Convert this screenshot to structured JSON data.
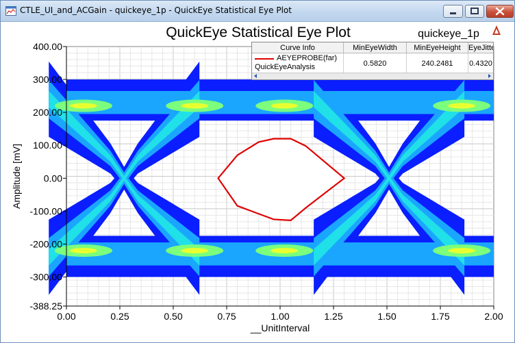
{
  "window": {
    "title": "CTLE_UI_and_ACGain - quickeye_1p - QuickEye Statistical Eye Plot",
    "icon": "app-icon",
    "controls": [
      "minimize-icon",
      "maximize-icon",
      "close-icon"
    ]
  },
  "plot": {
    "title": "QuickEye Statistical Eye Plot",
    "subtitle": "quickeye_1p",
    "logo": "ansys-logo",
    "xlabel": "__UnitInterval",
    "ylabel": "Amplitude [mV]"
  },
  "legend": {
    "columns": [
      "Curve Info",
      "MinEyeWidth",
      "MinEyeHeight",
      "EyeJitte..."
    ],
    "rows": [
      {
        "curve_line1": "AEYEPROBE(far)",
        "curve_line2": "QuickEyeAnalysis",
        "curve_color": "#e00000",
        "values": [
          "0.5820",
          "240.2481",
          "0.4320"
        ]
      }
    ]
  },
  "chart_data": {
    "type": "heatmap",
    "title": "QuickEye Statistical Eye Plot",
    "subtitle": "quickeye_1p",
    "xlabel": "__UnitInterval",
    "ylabel": "Amplitude [mV]",
    "xlim": [
      0,
      2
    ],
    "ylim": [
      -388.25,
      400
    ],
    "xticks": [
      "0.00",
      "0.25",
      "0.50",
      "0.75",
      "1.00",
      "1.25",
      "1.50",
      "1.75",
      "2.00"
    ],
    "yticks": [
      "400.00",
      "300.00",
      "200.00",
      "100.00",
      "0.00",
      "-100.00",
      "-200.00",
      "-300.00",
      "-388.25"
    ],
    "grid": true,
    "colormap": [
      "#0a1eff",
      "#1aa6ff",
      "#20e0e8",
      "#7cff7c",
      "#e8ff30"
    ],
    "eye_contour": {
      "name": "AEYEPROBE(far) QuickEyeAnalysis",
      "color": "#e00000",
      "x": [
        0.71,
        0.8,
        0.9,
        0.97,
        1.05,
        1.12,
        1.3,
        1.12,
        1.05,
        0.97,
        0.8,
        0.71
      ],
      "y": [
        0,
        70,
        110,
        120,
        120,
        98,
        0,
        -90,
        -128,
        -125,
        -84,
        0
      ]
    },
    "metrics": {
      "MinEyeWidth": 0.582,
      "MinEyeHeight": 240.2481,
      "EyeJitter": 0.432
    }
  }
}
